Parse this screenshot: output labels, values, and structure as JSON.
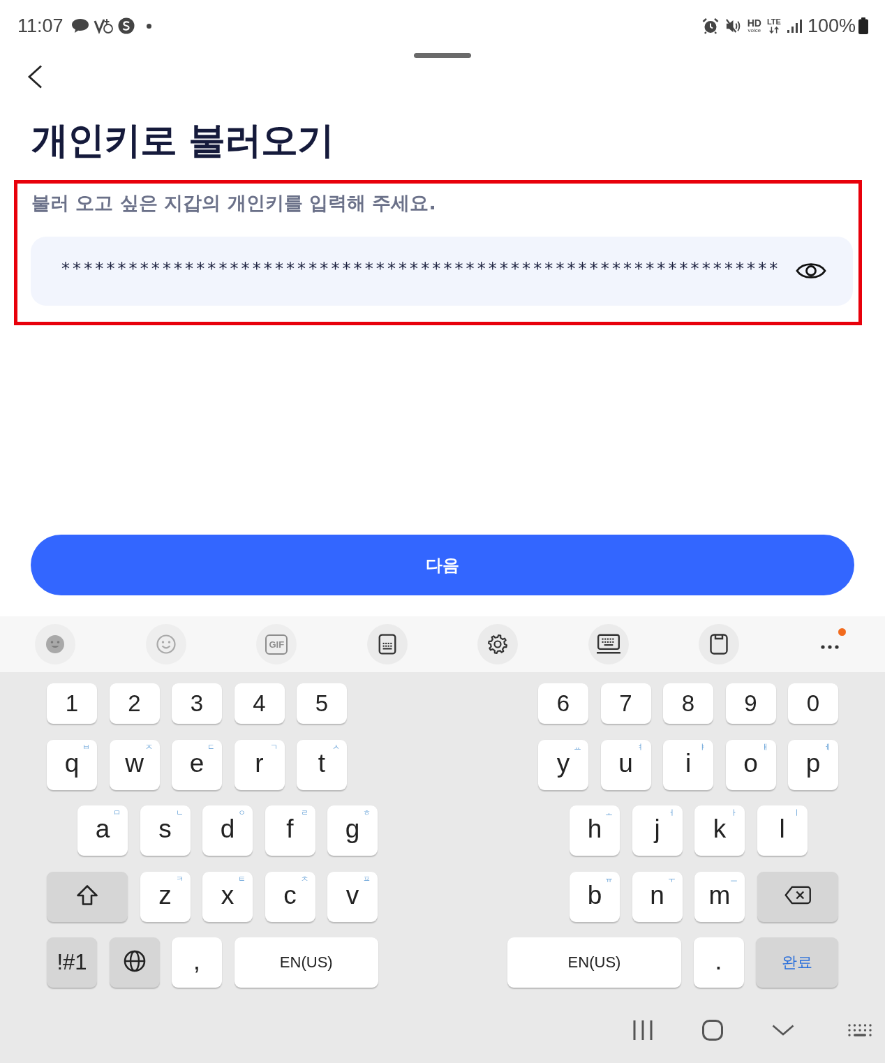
{
  "status_bar": {
    "time": "11:07",
    "notifications": [
      {
        "kind": "chat"
      },
      {
        "kind": "tick-ring"
      },
      {
        "kind": "circle-logo"
      },
      {
        "kind": "dot"
      }
    ],
    "indicators": [
      {
        "kind": "alarm"
      },
      {
        "kind": "mute"
      },
      {
        "kind": "hd-voice",
        "label": "HD",
        "sublabel": "voice"
      },
      {
        "kind": "lte",
        "label": "LTE"
      },
      {
        "kind": "signal"
      }
    ],
    "battery": "100%"
  },
  "title": "개인키로 불러오기",
  "prompt": {
    "highlighted": true,
    "label": "불러 오고 싶은 지갑의 개인키를 입력해 주세요.",
    "field": {
      "value": "****************************************************************",
      "masked": true
    }
  },
  "next_button": {
    "label": "다음"
  },
  "keyboard": {
    "toolbar": [
      {
        "kind": "emoji",
        "disabled": true
      },
      {
        "kind": "sticker",
        "disabled": true
      },
      {
        "kind": "gif",
        "label": "GIF",
        "disabled": true
      },
      {
        "kind": "keyboard-mode",
        "disabled": false
      },
      {
        "kind": "settings",
        "disabled": false
      },
      {
        "kind": "keyboard-layout",
        "disabled": false
      },
      {
        "kind": "clipboard",
        "disabled": false
      },
      {
        "kind": "more",
        "disabled": false,
        "notification": true
      }
    ],
    "rows": [
      {
        "left": [
          {
            "kind": "char",
            "label": "1"
          },
          {
            "kind": "char",
            "label": "2"
          },
          {
            "kind": "char",
            "label": "3"
          },
          {
            "kind": "char",
            "label": "4"
          },
          {
            "kind": "char",
            "label": "5"
          }
        ],
        "right": [
          {
            "kind": "char",
            "label": "6"
          },
          {
            "kind": "char",
            "label": "7"
          },
          {
            "kind": "char",
            "label": "8"
          },
          {
            "kind": "char",
            "label": "9"
          },
          {
            "kind": "char",
            "label": "0"
          }
        ]
      },
      {
        "left": [
          {
            "kind": "char",
            "label": "q",
            "hint": "ㅂ"
          },
          {
            "kind": "char",
            "label": "w",
            "hint": "ㅈ"
          },
          {
            "kind": "char",
            "label": "e",
            "hint": "ㄷ"
          },
          {
            "kind": "char",
            "label": "r",
            "hint": "ㄱ"
          },
          {
            "kind": "char",
            "label": "t",
            "hint": "ㅅ"
          }
        ],
        "right": [
          {
            "kind": "char",
            "label": "y",
            "hint": "ㅛ"
          },
          {
            "kind": "char",
            "label": "u",
            "hint": "ㅕ"
          },
          {
            "kind": "char",
            "label": "i",
            "hint": "ㅑ"
          },
          {
            "kind": "char",
            "label": "o",
            "hint": "ㅐ"
          },
          {
            "kind": "char",
            "label": "p",
            "hint": "ㅔ"
          }
        ]
      },
      {
        "left": [
          {
            "kind": "char",
            "label": "a",
            "hint": "ㅁ"
          },
          {
            "kind": "char",
            "label": "s",
            "hint": "ㄴ"
          },
          {
            "kind": "char",
            "label": "d",
            "hint": "ㅇ"
          },
          {
            "kind": "char",
            "label": "f",
            "hint": "ㄹ"
          },
          {
            "kind": "char",
            "label": "g",
            "hint": "ㅎ"
          }
        ],
        "right": [
          {
            "kind": "char",
            "label": "h",
            "hint": "ㅗ"
          },
          {
            "kind": "char",
            "label": "j",
            "hint": "ㅓ"
          },
          {
            "kind": "char",
            "label": "k",
            "hint": "ㅏ"
          },
          {
            "kind": "char",
            "label": "l",
            "hint": "ㅣ"
          }
        ]
      },
      {
        "left": [
          {
            "kind": "shift"
          },
          {
            "kind": "char",
            "label": "z",
            "hint": "ㅋ"
          },
          {
            "kind": "char",
            "label": "x",
            "hint": "ㅌ"
          },
          {
            "kind": "char",
            "label": "c",
            "hint": "ㅊ"
          },
          {
            "kind": "char",
            "label": "v",
            "hint": "ㅍ"
          }
        ],
        "right": [
          {
            "kind": "char",
            "label": "b",
            "hint": "ㅠ"
          },
          {
            "kind": "char",
            "label": "n",
            "hint": "ㅜ"
          },
          {
            "kind": "char",
            "label": "m",
            "hint": "ㅡ"
          },
          {
            "kind": "backspace"
          }
        ]
      },
      {
        "left": [
          {
            "kind": "symbols",
            "label": "!#1"
          },
          {
            "kind": "language"
          },
          {
            "kind": "char",
            "label": ","
          },
          {
            "kind": "space",
            "label": "EN(US)"
          }
        ],
        "right": [
          {
            "kind": "space",
            "label": "EN(US)"
          },
          {
            "kind": "char",
            "label": "."
          },
          {
            "kind": "done",
            "label": "완료"
          }
        ]
      }
    ]
  },
  "nav_bar": [
    {
      "kind": "recents"
    },
    {
      "kind": "home"
    },
    {
      "kind": "hide-keyboard"
    },
    {
      "kind": "keyboard-switch"
    }
  ]
}
